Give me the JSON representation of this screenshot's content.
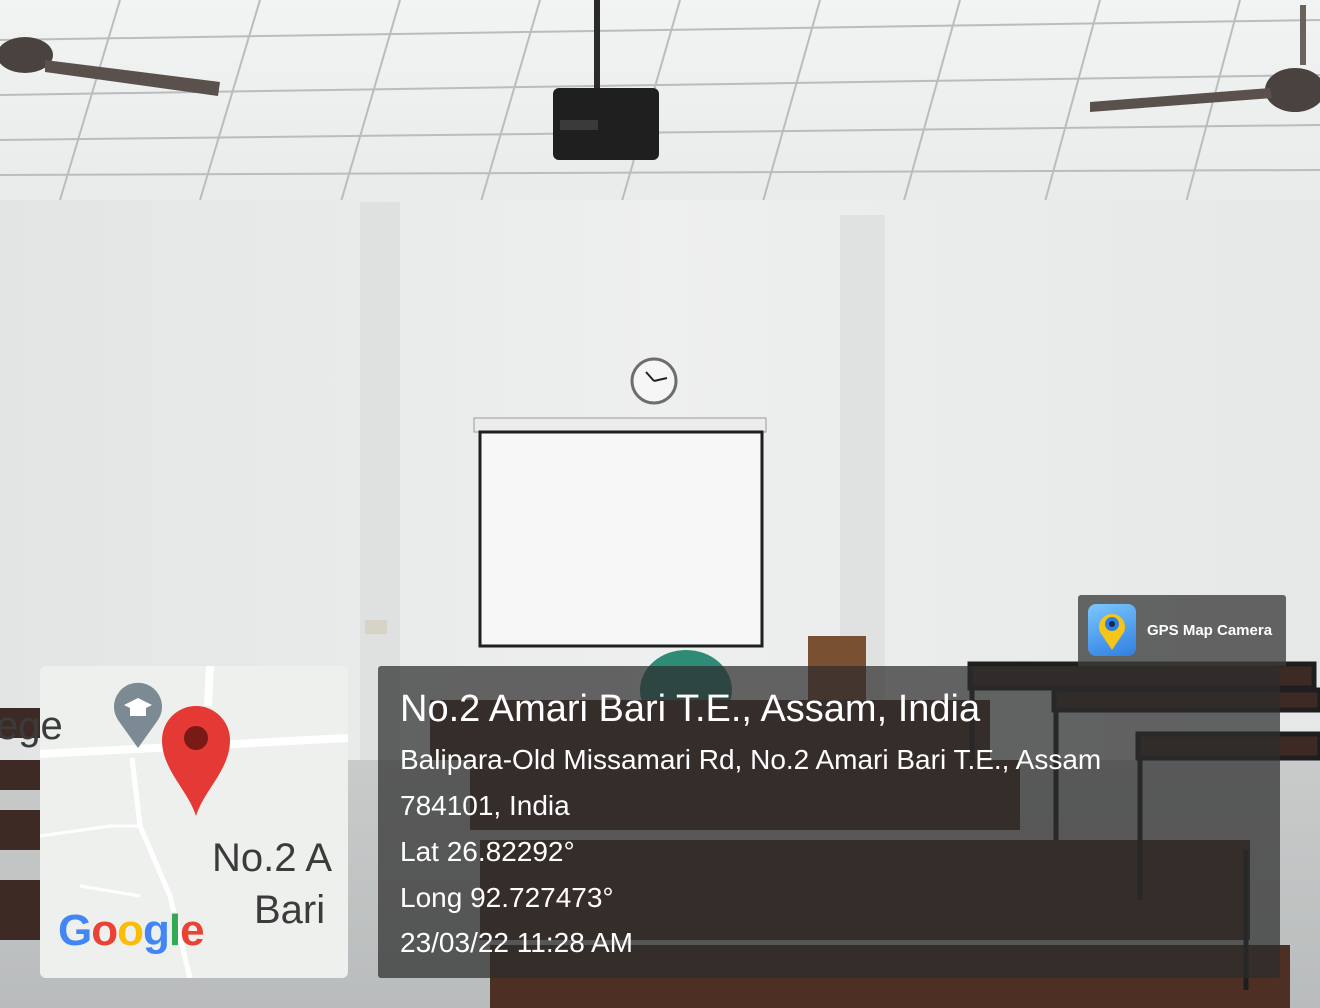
{
  "overlay": {
    "place_title": "No.2 Amari Bari T.E., Assam, India",
    "address_line1": "Balipara-Old Missamari Rd, No.2 Amari Bari T.E., Assam",
    "address_line2": "784101, India",
    "latitude": "Lat 26.82292°",
    "longitude": "Long 92.727473°",
    "datetime": "23/03/22 11:28 AM"
  },
  "brand": {
    "app_name": "GPS Map Camera",
    "icon": "map-camera-icon"
  },
  "map": {
    "partial_label": "ege",
    "place_label_line1": "No.2 A",
    "place_label_line2": "Bari ",
    "logo_letters": [
      "G",
      "o",
      "o",
      "g",
      "l",
      "e"
    ],
    "logo_colors": [
      "#4285F4",
      "#EA4335",
      "#FBBC05",
      "#4285F4",
      "#34A853",
      "#EA4335"
    ],
    "icons": [
      "school-pin-icon",
      "location-pin-icon"
    ],
    "pin_color": "#E53935"
  }
}
